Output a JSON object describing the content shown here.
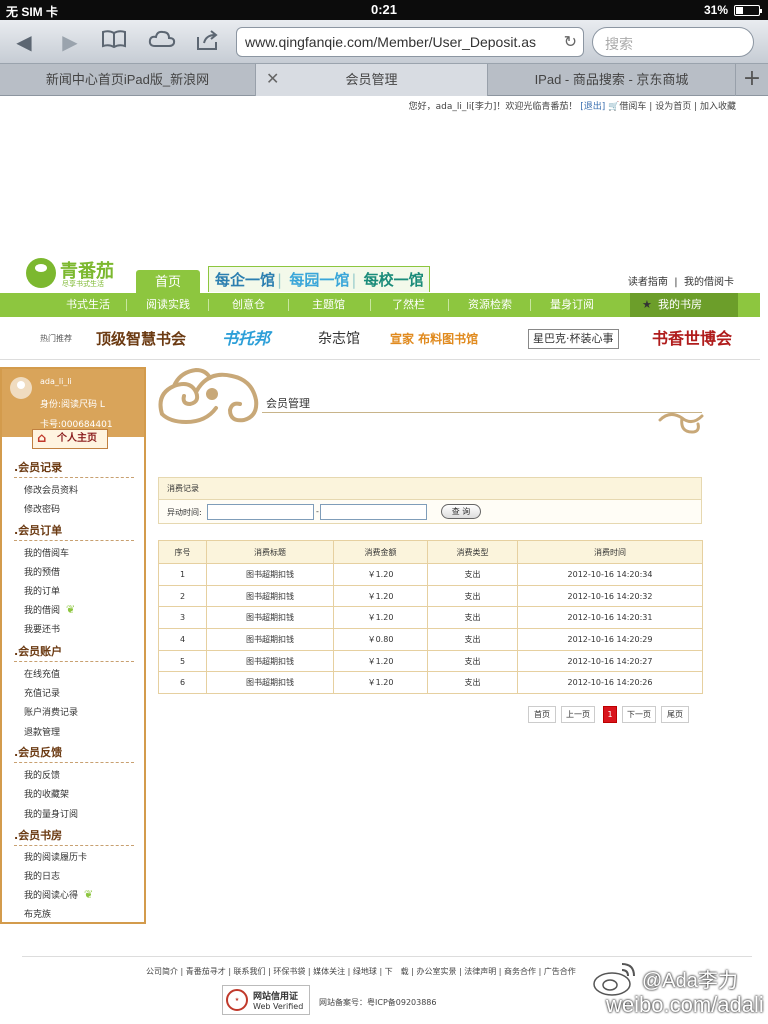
{
  "status_bar": {
    "carrier": "无 SIM 卡",
    "time": "0:21",
    "battery": "31%"
  },
  "browser": {
    "url": "www.qingfanqie.com/Member/User_Deposit.as",
    "search_placeholder": "搜索",
    "tabs": [
      {
        "label": "新闻中心首页iPad版_新浪网"
      },
      {
        "label": "会员管理"
      },
      {
        "label": "IPad - 商品搜索 - 京东商城"
      }
    ]
  },
  "topline": {
    "greeting": "您好，ada_li_li[李力]！欢迎光临青番茄！",
    "logout": "[退出]",
    "cart": "借阅车",
    "set_home": "设为首页",
    "bookmark": "加入收藏"
  },
  "site": {
    "name": "青番茄",
    "slogan": "尽享书式生活",
    "home_tab": "首页",
    "promo": [
      "每企一馆",
      "每园一馆",
      "每校一馆"
    ],
    "reader_guide": "读者指南",
    "my_borrow_card": "我的借阅卡"
  },
  "nav": {
    "items": [
      "书式生活",
      "阅读实践",
      "创意仓",
      "主题馆",
      "了然栏",
      "资源检索",
      "量身订阅"
    ],
    "my_library": "我的书房"
  },
  "hot": {
    "label": "热门推荐",
    "items": [
      "顶级智慧书会",
      "书托邦",
      "杂志馆",
      "宣家 布料图书馆",
      "星巴克·杯装心事",
      "书香世博会"
    ]
  },
  "sidebar": {
    "username": "ada_li_li",
    "identity": "身份:阅读尺码 L",
    "card_no": "卡号:000684401",
    "homepage_btn": "个人主页",
    "sections": [
      {
        "title": ".会员记录",
        "links": [
          "修改会员资料",
          "修改密码"
        ]
      },
      {
        "title": ".会员订单",
        "links": [
          "我的借阅车",
          "我的预借",
          "我的订单",
          "我的借阅",
          "我要还书"
        ]
      },
      {
        "title": ".会员账户",
        "links": [
          "在线充值",
          "充值记录",
          "账户消费记录",
          "退款管理"
        ]
      },
      {
        "title": ".会员反馈",
        "links": [
          "我的反馈",
          "我的收藏架",
          "我的量身订阅"
        ]
      },
      {
        "title": ".会员书房",
        "links": [
          "我的阅读履历卡",
          "我的日志",
          "我的阅读心得",
          "布克族"
        ]
      }
    ]
  },
  "main": {
    "title": "会员管理",
    "filter": {
      "heading": "消费记录",
      "label": "异动时间:",
      "separator": "-",
      "query_btn": "查 询"
    },
    "table": {
      "headers": [
        "序号",
        "消费标题",
        "消费金额",
        "消费类型",
        "消费时间"
      ],
      "rows": [
        [
          "1",
          "图书超期扣钱",
          "￥1.20",
          "支出",
          "2012-10-16 14:20:34"
        ],
        [
          "2",
          "图书超期扣钱",
          "￥1.20",
          "支出",
          "2012-10-16 14:20:32"
        ],
        [
          "3",
          "图书超期扣钱",
          "￥1.20",
          "支出",
          "2012-10-16 14:20:31"
        ],
        [
          "4",
          "图书超期扣钱",
          "￥0.80",
          "支出",
          "2012-10-16 14:20:29"
        ],
        [
          "5",
          "图书超期扣钱",
          "￥1.20",
          "支出",
          "2012-10-16 14:20:27"
        ],
        [
          "6",
          "图书超期扣钱",
          "￥1.20",
          "支出",
          "2012-10-16 14:20:26"
        ]
      ]
    },
    "pager": {
      "first": "首页",
      "prev": "上一页",
      "current": "1",
      "next": "下一页",
      "last": "尾页"
    }
  },
  "footer": {
    "links": "公司简介 | 青番茄寻才 | 联系我们 | 环保书袋 | 媒体关注 | 绿地球 | 下　载 | 办公室实景 | 法律声明 | 商务合作 | 广告合作",
    "credit_title": "网站信用证",
    "credit_sub": "Web Verified",
    "icp": "网站备案号：粤ICP备09203886"
  },
  "watermark": {
    "name": "@Ada李力",
    "url": "weibo.com/adali"
  },
  "colors": {
    "brand_green": "#8dc63f",
    "sidebar_tan": "#d9a45a",
    "pager_active": "#d9141c"
  }
}
